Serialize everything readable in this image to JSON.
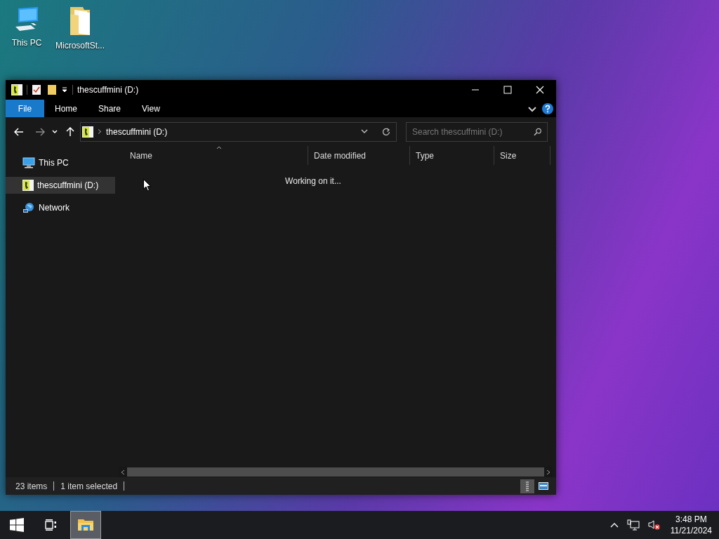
{
  "desktop": {
    "icons": [
      {
        "label": "This PC",
        "kind": "computer"
      },
      {
        "label": "MicrosoftSt...",
        "kind": "folder"
      }
    ]
  },
  "window": {
    "title": "thescuffmini (D:)",
    "ribbon_tabs": [
      {
        "label": "File",
        "kind": "file-menu"
      },
      {
        "label": "Home",
        "kind": "tab"
      },
      {
        "label": "Share",
        "kind": "tab"
      },
      {
        "label": "View",
        "kind": "tab"
      }
    ],
    "address": "thescuffmini (D:)",
    "search": {
      "placeholder": "Search thescuffmini (D:)"
    },
    "sidebar": {
      "items": [
        {
          "label": "This PC",
          "kind": "computer",
          "selected": false
        },
        {
          "label": "thescuffmini (D:)",
          "kind": "drive",
          "selected": true
        },
        {
          "label": "Network",
          "kind": "network",
          "selected": false
        }
      ]
    },
    "columns": [
      {
        "label": "Name",
        "sorted": true
      },
      {
        "label": "Date modified",
        "sorted": false
      },
      {
        "label": "Type",
        "sorted": false
      },
      {
        "label": "Size",
        "sorted": false
      }
    ],
    "message": "Working on it...",
    "status_bar": {
      "item_count": "23 items",
      "selection": "1 item selected"
    },
    "view_modes": [
      {
        "kind": "details",
        "selected": true
      },
      {
        "kind": "tiles",
        "selected": false
      }
    ]
  },
  "taskbar": {
    "apps": [
      {
        "kind": "file-explorer",
        "selected": true
      }
    ],
    "tray": {
      "volume_muted": true
    },
    "time": "3:48 PM",
    "date": "11/21/2024"
  }
}
